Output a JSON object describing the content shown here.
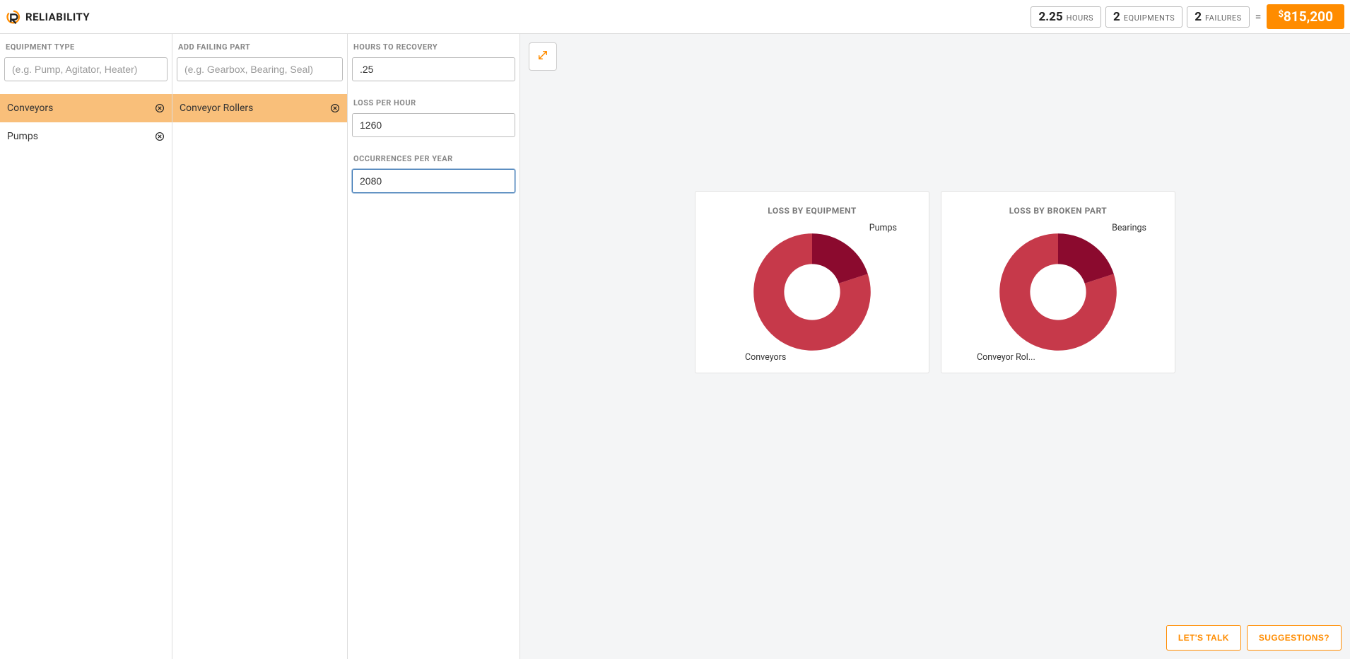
{
  "brand": "RELIABILITY",
  "header_stats": {
    "hours_value": "2.25",
    "hours_label": "HOURS",
    "equipments_value": "2",
    "equipments_label": "EQUIPMENTS",
    "failures_value": "2",
    "failures_label": "FAILURES",
    "equals": "=",
    "total": "815,200",
    "currency": "$"
  },
  "left_panel": {
    "label": "EQUIPMENT TYPE",
    "placeholder": "(e.g. Pump, Agitator, Heater)",
    "items": [
      {
        "name": "Conveyors",
        "selected": true
      },
      {
        "name": "Pumps",
        "selected": false
      }
    ]
  },
  "mid_panel": {
    "label": "ADD FAILING PART",
    "placeholder": "(e.g. Gearbox, Bearing, Seal)",
    "items": [
      {
        "name": "Conveyor Rollers",
        "selected": true
      }
    ]
  },
  "right_panel": {
    "hours_label": "HOURS TO RECOVERY",
    "hours_value": ".25",
    "loss_label": "LOSS PER HOUR",
    "loss_value": "1260",
    "occ_label": "OCCURRENCES PER YEAR",
    "occ_value": "2080"
  },
  "charts": {
    "equipment_title": "LOSS BY EQUIPMENT",
    "part_title": "LOSS BY BROKEN PART"
  },
  "chart_data": [
    {
      "type": "pie",
      "title": "LOSS BY EQUIPMENT",
      "series": [
        {
          "name": "Conveyors",
          "value": 80,
          "color": "#c6394a"
        },
        {
          "name": "Pumps",
          "value": 20,
          "color": "#8b0a2e"
        }
      ]
    },
    {
      "type": "pie",
      "title": "LOSS BY BROKEN PART",
      "series": [
        {
          "name": "Conveyor Rol...",
          "value": 80,
          "color": "#c6394a"
        },
        {
          "name": "Bearings",
          "value": 20,
          "color": "#8b0a2e"
        }
      ]
    }
  ],
  "buttons": {
    "lets_talk": "LET'S TALK",
    "suggestions": "SUGGESTIONS?"
  }
}
